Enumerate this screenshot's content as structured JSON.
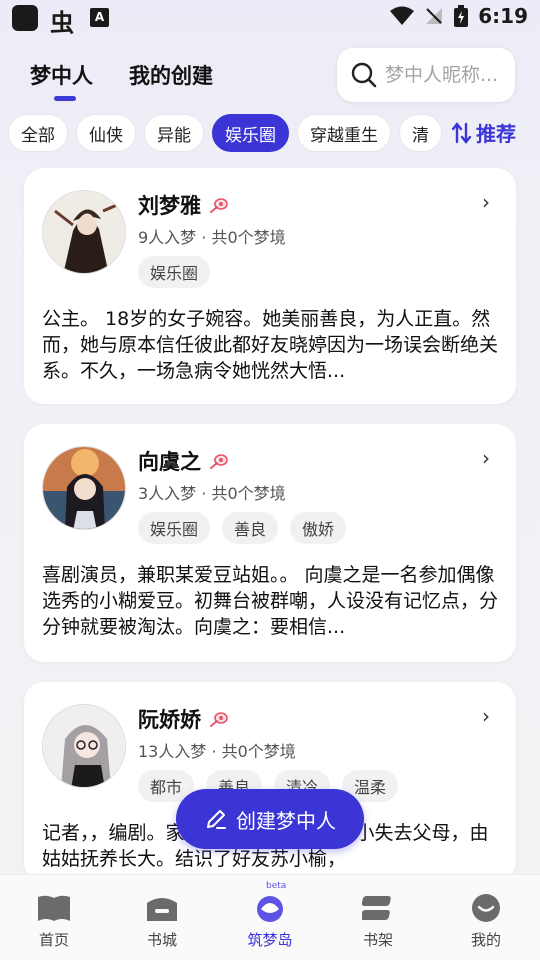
{
  "status_bar": {
    "time": "6:19",
    "app_badge": "A"
  },
  "header": {
    "tabs": [
      {
        "label": "梦中人"
      },
      {
        "label": "我的创建"
      }
    ],
    "search": {
      "placeholder": "梦中人昵称..."
    }
  },
  "categories": [
    {
      "label": "全部"
    },
    {
      "label": "仙侠"
    },
    {
      "label": "异能"
    },
    {
      "label": "娱乐圈"
    },
    {
      "label": "穿越重生"
    },
    {
      "label": "清"
    }
  ],
  "active_category": "娱乐圈",
  "sort": {
    "label": "推荐"
  },
  "cards": [
    {
      "name": "刘梦雅",
      "meta": "9人入梦 · 共0个梦境",
      "tags": [
        "娱乐圈"
      ],
      "description": "公主。 18岁的女子婉容。她美丽善良，为人正直。然而，她与原本信任彼此都好友晓婷因为一场误会断绝关系。不久，一场急病令她恍然大悟..."
    },
    {
      "name": "向虞之",
      "meta": "3人入梦 · 共0个梦境",
      "tags": [
        "娱乐圈",
        "善良",
        "傲娇"
      ],
      "description": "喜剧演员，兼职某爱豆站姐。。 向虞之是一名参加偶像选秀的小糊爱豆。初舞台被群嘲，人设没有记忆点，分分钟就要被淘汰。向虞之：要相信..."
    },
    {
      "name": "阮娇娇",
      "meta": "13人入梦 · 共0个梦境",
      "tags": [
        "都市",
        "善良",
        "清冷",
        "温柔"
      ],
      "description": "记者，，编剧。家庭背景坎坷不断。从小失去父母，由姑姑抚养长大。结识了好友苏小榆，"
    }
  ],
  "fab": {
    "label": "创建梦中人"
  },
  "bottom_nav": [
    {
      "label": "首页"
    },
    {
      "label": "书城"
    },
    {
      "label": "筑梦岛",
      "badge": "beta"
    },
    {
      "label": "书架"
    },
    {
      "label": "我的"
    }
  ],
  "colors": {
    "accent": "#3b35d6",
    "pin": "#e8546a"
  }
}
